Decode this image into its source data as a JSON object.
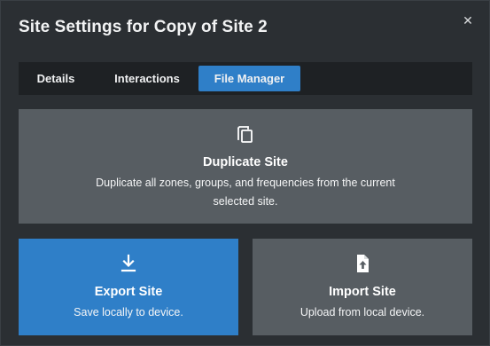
{
  "dialog": {
    "title": "Site Settings for Copy of Site 2",
    "close_icon": "close-icon"
  },
  "tabs": [
    {
      "label": "Details",
      "active": false
    },
    {
      "label": "Interactions",
      "active": false
    },
    {
      "label": "File Manager",
      "active": true
    }
  ],
  "cards": {
    "duplicate": {
      "icon": "copy-icon",
      "title": "Duplicate Site",
      "description": "Duplicate all zones, groups, and frequencies from the current selected site."
    },
    "export": {
      "icon": "download-icon",
      "title": "Export Site",
      "description": "Save locally to device."
    },
    "import": {
      "icon": "file-upload-icon",
      "title": "Import Site",
      "description": "Upload from local device."
    }
  },
  "colors": {
    "accent": "#2f7fc8",
    "card": "#575d62",
    "background": "#2b2f33",
    "tabbar": "#1e2124"
  }
}
